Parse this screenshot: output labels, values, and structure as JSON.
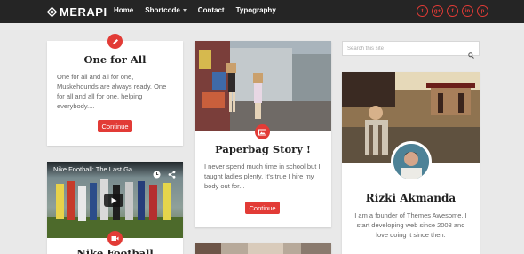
{
  "brand": {
    "name": "MERAPI",
    "accent": "#e23b36"
  },
  "nav": [
    {
      "label": "Home"
    },
    {
      "label": "Shortcode"
    },
    {
      "label": "Contact"
    },
    {
      "label": "Typography"
    }
  ],
  "socials": [
    {
      "icon": "twitter-icon",
      "glyph": "t"
    },
    {
      "icon": "google-plus-icon",
      "glyph": "g+"
    },
    {
      "icon": "facebook-icon",
      "glyph": "f"
    },
    {
      "icon": "linkedin-icon",
      "glyph": "in"
    },
    {
      "icon": "pinterest-icon",
      "glyph": "p"
    }
  ],
  "search": {
    "placeholder": "Search this site"
  },
  "posts": [
    {
      "title": "One for All",
      "excerpt": "One for all and all for one, Muskehounds are always ready. One for all and all for one, helping everybody....",
      "button": "Continue",
      "badge_icon": "pencil-icon"
    },
    {
      "title": "Paperbag Story !",
      "excerpt": "I never spend much time in school but I taught ladies plenty. It's true I hire my body out for...",
      "button": "Continue",
      "badge_icon": "image-icon"
    },
    {
      "title": "Nike Football",
      "video_title": "Nike Football: The Last Ga...",
      "badge_icon": "video-icon"
    }
  ],
  "profile": {
    "name": "Rizki Akmanda",
    "bio": "I am a founder of Themes Awesome. I start developing web since 2008 and love doing it since then."
  }
}
